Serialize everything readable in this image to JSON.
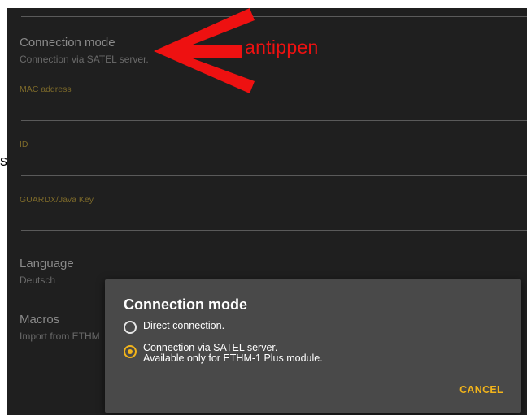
{
  "settings": {
    "connection_mode": {
      "title": "Connection mode",
      "value": "Connection via SATEL server."
    },
    "mac_address": {
      "label": "MAC address"
    },
    "id": {
      "label": "ID"
    },
    "guardx_key": {
      "label": "GUARDX/Java Key"
    },
    "language": {
      "title": "Language",
      "value": "Deutsch"
    },
    "macros": {
      "title": "Macros",
      "value": "Import from ETHM"
    }
  },
  "stray_text": "st",
  "annotation": {
    "text": "antippen",
    "color": "#ee1111"
  },
  "dialog": {
    "title": "Connection mode",
    "options": [
      {
        "line1": "Direct connection.",
        "line2": "",
        "selected": false
      },
      {
        "line1": "Connection via SATEL server.",
        "line2": "Available only for ETHM-1 Plus module.",
        "selected": true
      }
    ],
    "cancel_label": "CANCEL"
  },
  "colors": {
    "accent": "#f2b41b",
    "background": "#1f1f1f",
    "dialog": "#494949"
  }
}
